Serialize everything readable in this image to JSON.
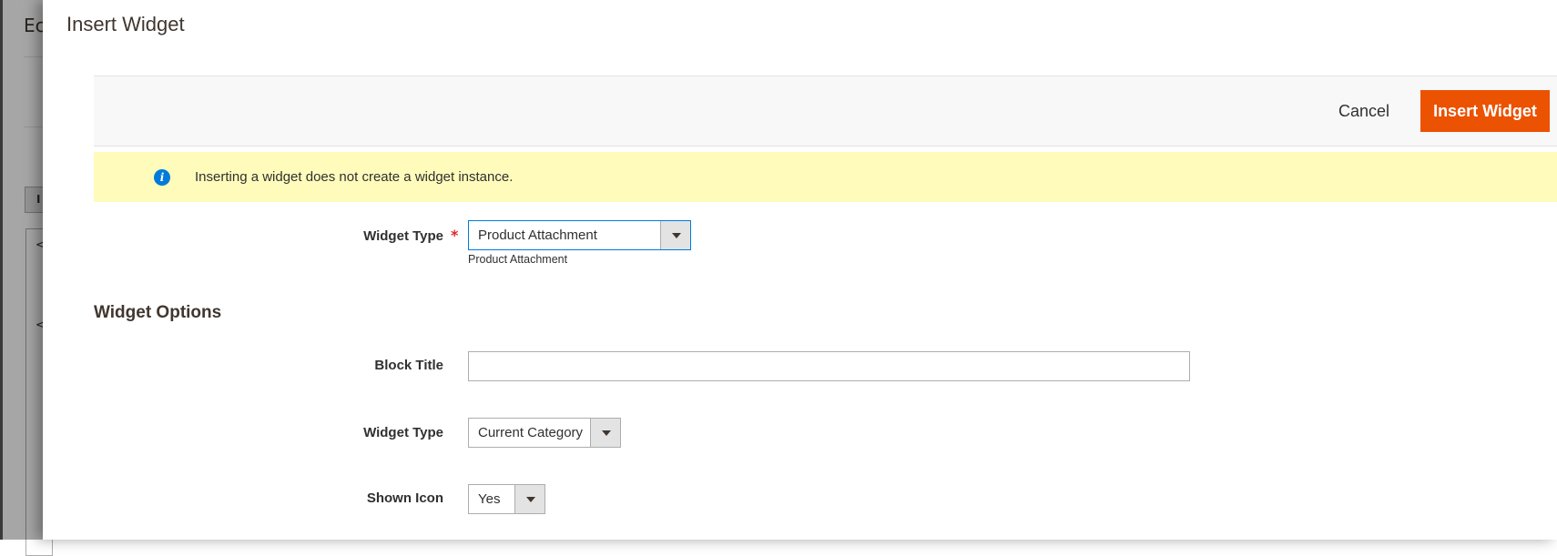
{
  "background": {
    "title_fragment": "Ec",
    "chip_text": "I",
    "editor_lines": [
      "<",
      "<"
    ]
  },
  "modal": {
    "title": "Insert Widget",
    "actions": {
      "cancel_label": "Cancel",
      "insert_label": "Insert Widget"
    },
    "message": {
      "icon": "info-icon",
      "text": "Inserting a widget does not create a widget instance."
    },
    "widget_type_field": {
      "label": "Widget Type",
      "required": true,
      "value": "Product Attachment",
      "note": "Product Attachment"
    },
    "options_section": {
      "title": "Widget Options",
      "block_title": {
        "label": "Block Title",
        "value": ""
      },
      "widget_type": {
        "label": "Widget Type",
        "value": "Current Category"
      },
      "shown_icon": {
        "label": "Shown Icon",
        "value": "Yes"
      }
    }
  },
  "colors": {
    "accent": "#eb5202",
    "message_bg": "#fffbbb",
    "info_icon": "#007bdb",
    "required": "#e22626"
  }
}
